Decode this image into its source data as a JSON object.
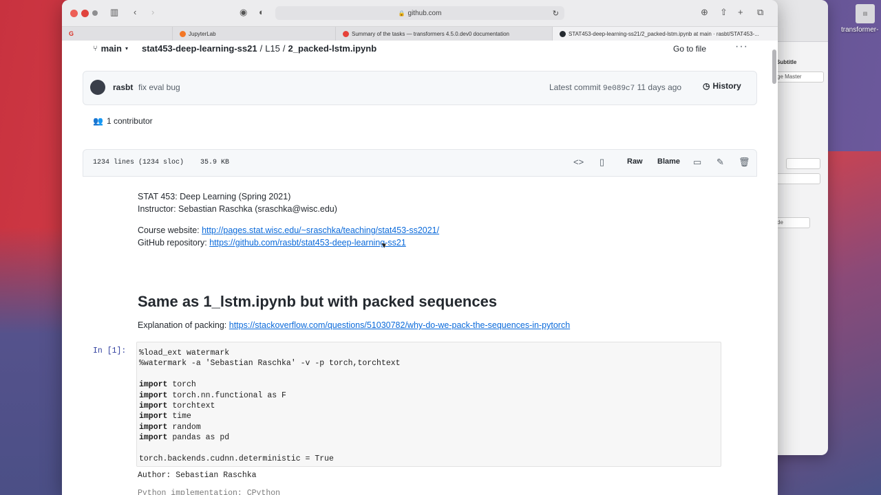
{
  "browser": {
    "url": "github.com",
    "tabs": [
      {
        "label": "JupyterLab"
      },
      {
        "label": "Summary of the tasks — transformers 4.5.0.dev0 documentation"
      },
      {
        "label": "STAT453-deep-learning-ss21/2_packed-lstm.ipynb at main · rasbt/STAT453-..."
      }
    ]
  },
  "background_app": {
    "items": [
      "Subtitle",
      "ge Master",
      "de"
    ],
    "desktop_label": "transformer-"
  },
  "repo": {
    "branch": "main",
    "repo_name": "stat453-deep-learning-ss21",
    "folder": "L15",
    "file": "2_packed-lstm.ipynb",
    "goto_file": "Go to file",
    "more": "···"
  },
  "commit": {
    "author": "rasbt",
    "message": "fix eval bug",
    "latest_label": "Latest commit",
    "sha": "9e089c7",
    "when": "11 days ago",
    "history": "History"
  },
  "contributors": "1 contributor",
  "file_info": {
    "lines": "1234 lines (1234 sloc)",
    "size": "35.9 KB",
    "raw": "Raw",
    "blame": "Blame"
  },
  "notebook": {
    "course": "STAT 453: Deep Learning (Spring 2021)",
    "instructor": "Instructor: Sebastian Raschka (sraschka@wisc.edu)",
    "website_label": "Course website:",
    "website_url": "http://pages.stat.wisc.edu/~sraschka/teaching/stat453-ss2021/",
    "repo_label": "GitHub repository:",
    "repo_url": "https://github.com/rasbt/stat453-deep-learning-ss21",
    "heading": "Same as 1_lstm.ipynb but with packed sequences",
    "explain_label": "Explanation of packing:",
    "explain_url": "https://stackoverflow.com/questions/51030782/why-do-we-pack-the-sequences-in-pytorch",
    "prompt": "In [1]:",
    "code_lines": [
      "%load_ext watermark",
      "%watermark -a 'Sebastian Raschka' -v -p torch,torchtext",
      "",
      "import torch",
      "import torch.nn.functional as F",
      "import torchtext",
      "import time",
      "import random",
      "import pandas as pd",
      "",
      "torch.backends.cudnn.deterministic = True"
    ],
    "output": "Author: Sebastian Raschka",
    "output2": "Python implementation: CPython"
  }
}
